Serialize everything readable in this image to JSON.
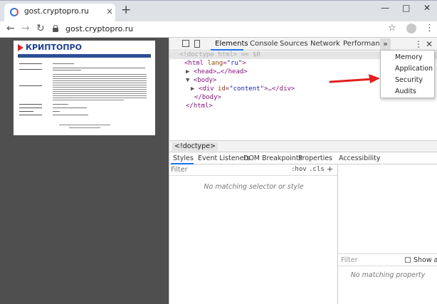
{
  "browser": {
    "tab_title": "gost.cryptopro.ru",
    "tab_close": "×",
    "new_tab": "+",
    "url": "gost.cryptopro.ru",
    "window_controls": [
      "—",
      "□",
      "✕"
    ]
  },
  "page": {
    "logo_text": "КРИПТОПРО"
  },
  "devtools": {
    "tabs": [
      "Elements",
      "Console",
      "Sources",
      "Network",
      "Performance"
    ],
    "more": "»",
    "overflow_menu": [
      "Memory",
      "Application",
      "Security",
      "Audits"
    ],
    "dom": {
      "doctype": "<!doctype html>",
      "eq0": " == $0",
      "html_open": "<html",
      "lang_attr": "lang",
      "lang_val": "\"ru\"",
      "head": "<head>…</head>",
      "body_open": "<body>",
      "div_open": "<div",
      "id_attr": "id",
      "id_val": "\"content\"",
      "div_close": ">…</div>",
      "body_close": "</body>",
      "html_close": "</html>"
    },
    "breadcrumb": "<!doctype>",
    "sub_tabs": [
      "Styles",
      "Event Listeners",
      "DOM Breakpoints",
      "Properties",
      "Accessibility"
    ],
    "styles": {
      "filter_placeholder": "Filter",
      "hov": ":hov",
      "cls": ".cls",
      "plus": "+",
      "empty": "No matching selector or style"
    },
    "computed": {
      "filter_placeholder": "Filter",
      "show_all": "Show all",
      "empty": "No matching property"
    }
  },
  "colors": {
    "accent": "#1a73e8",
    "arrow": "#e0201d",
    "logo_blue": "#1f3f8f",
    "logo_red": "#d6232a"
  }
}
